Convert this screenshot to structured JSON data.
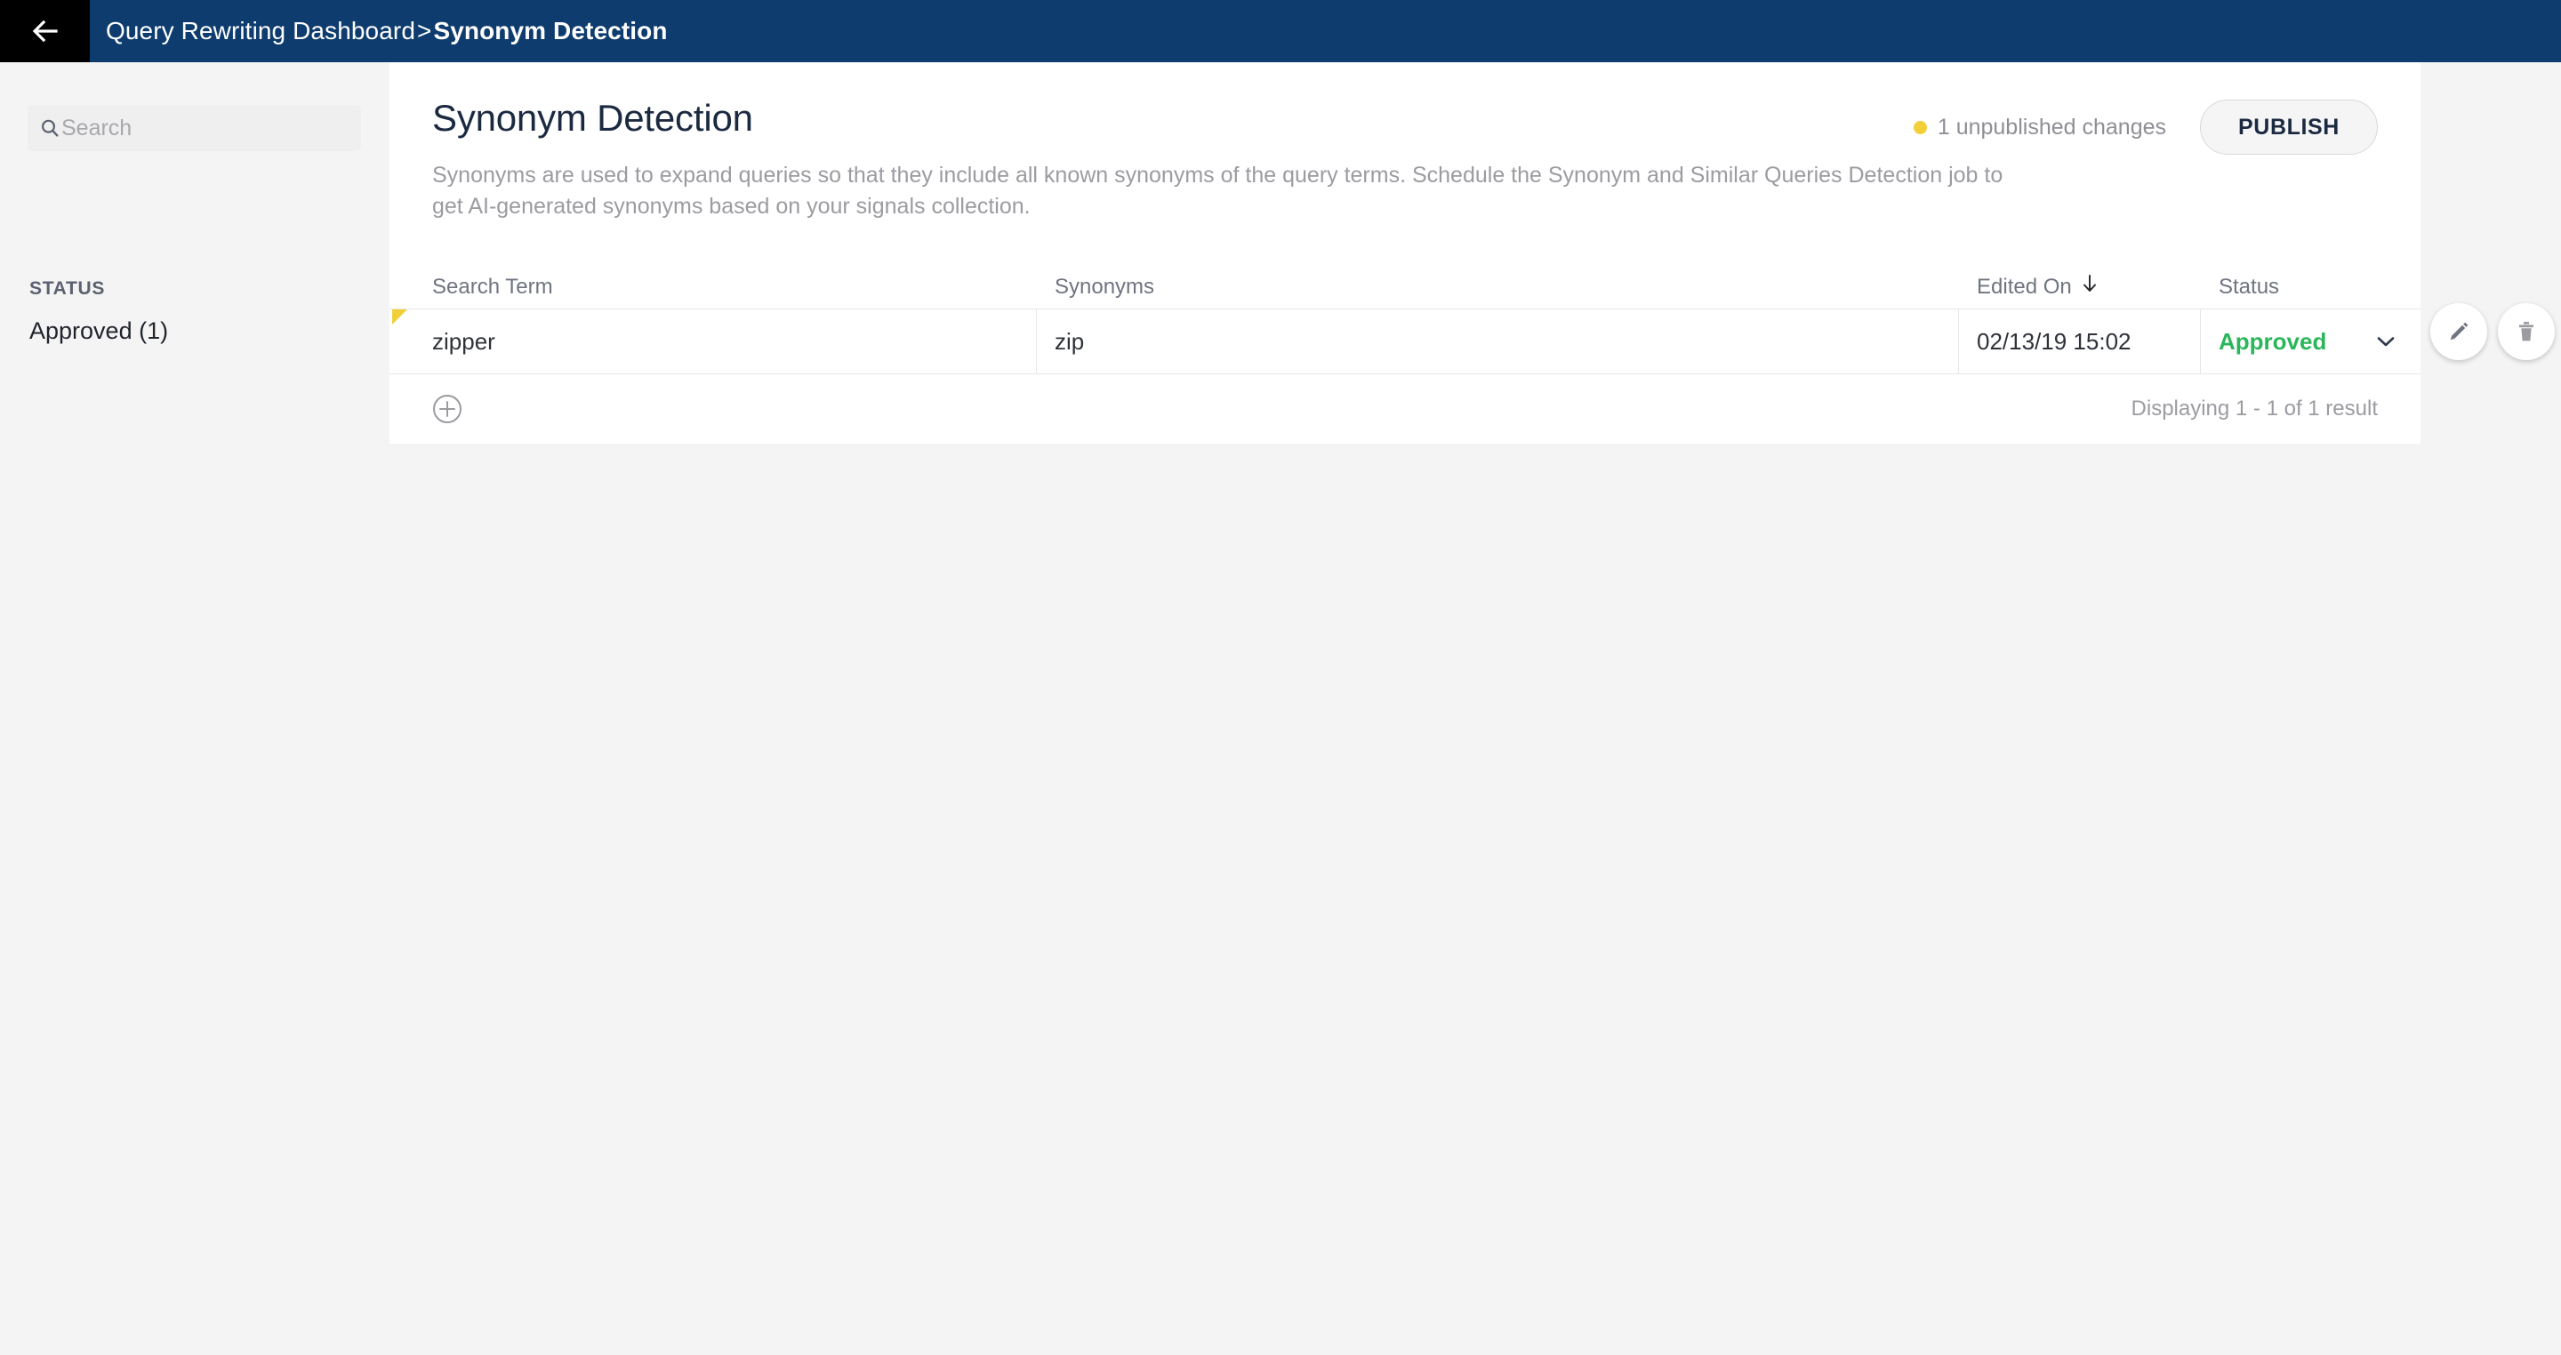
{
  "topbar": {
    "back_icon": "arrow-left-icon",
    "breadcrumb_root": "Query Rewriting Dashboard",
    "breadcrumb_separator": ">",
    "breadcrumb_current": "Synonym Detection"
  },
  "sidebar": {
    "search": {
      "icon": "search-icon",
      "placeholder": "Search",
      "value": ""
    },
    "facets": [
      {
        "label": "STATUS",
        "items": [
          {
            "label": "Approved (1)"
          }
        ]
      }
    ],
    "status_heading": "STATUS",
    "status_item_0": "Approved (1)"
  },
  "main": {
    "title": "Synonym Detection",
    "description": "Synonyms are used to expand queries so that they include all known synonyms of the query terms. Schedule the Synonym and Similar Queries Detection job to get AI-generated synonyms based on your signals collection.",
    "unpublished": {
      "dot_color": "#f2cf38",
      "text": "1 unpublished changes"
    },
    "publish_label": "PUBLISH",
    "table": {
      "columns": [
        {
          "key": "term",
          "label": "Search Term"
        },
        {
          "key": "syn",
          "label": "Synonyms"
        },
        {
          "key": "edited",
          "label": "Edited On",
          "sort": "desc",
          "sort_icon": "arrow-down-icon"
        },
        {
          "key": "status",
          "label": "Status"
        }
      ],
      "headers": {
        "search_term": "Search Term",
        "synonyms": "Synonyms",
        "edited_on": "Edited On",
        "status": "Status"
      },
      "rows": [
        {
          "term": "zipper",
          "synonyms": "zip",
          "edited_on": "02/13/19 15:02",
          "status": "Approved",
          "status_color": "#2ab65a",
          "unpublished_flag": true
        }
      ],
      "row0": {
        "term": "zipper",
        "synonyms": "zip",
        "edited_on": "02/13/19 15:02",
        "status": "Approved"
      },
      "footer": {
        "add_icon": "plus-circle-icon",
        "result_count": "Displaying 1 - 1 of 1 result"
      }
    },
    "row_actions": {
      "edit_icon": "pencil-icon",
      "delete_icon": "trash-icon"
    }
  },
  "colors": {
    "header_bar": "#0e3c6e",
    "back_button": "#000000",
    "accent_warning": "#f2cf38",
    "status_approved": "#2ab65a",
    "page_background": "#f4f4f5",
    "panel_background": "#ffffff"
  }
}
